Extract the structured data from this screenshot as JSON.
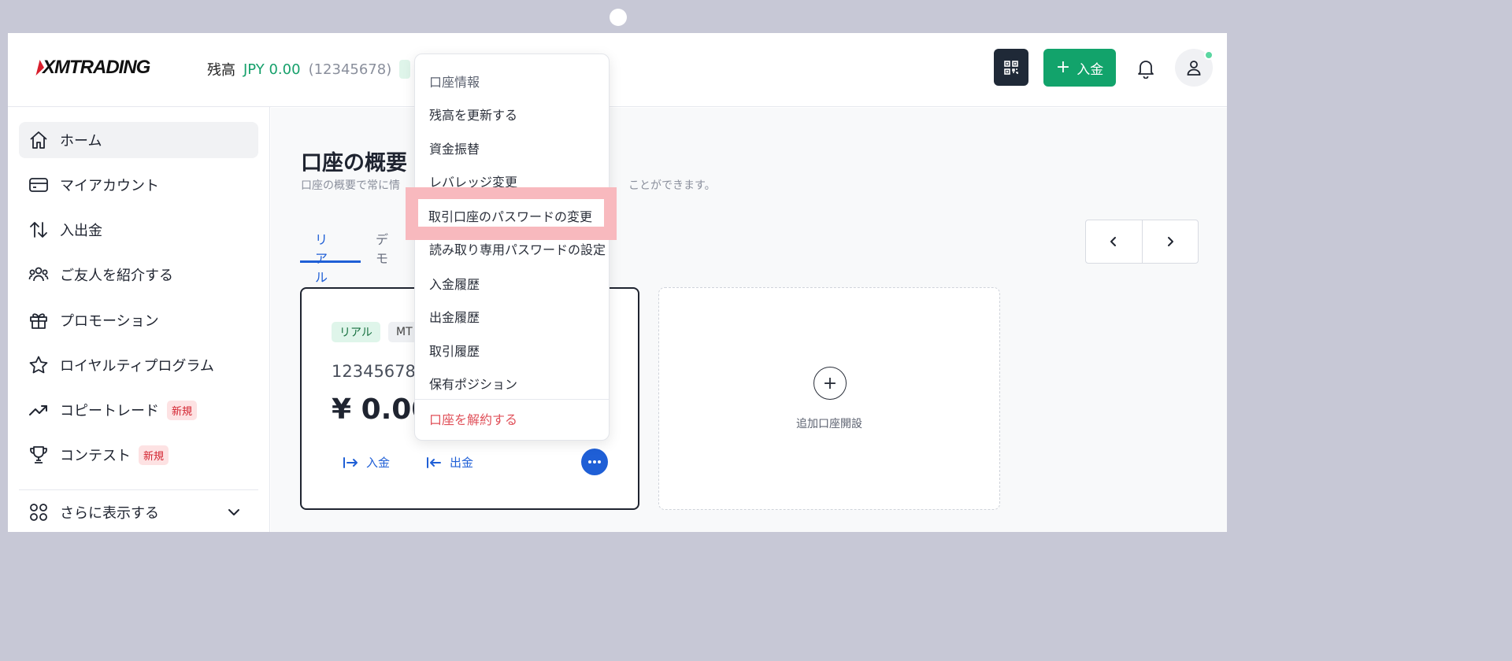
{
  "header": {
    "logo_text": "XMTRADING",
    "balance_label": "残高",
    "balance_amount": "JPY 0.00",
    "account_id": "(12345678)",
    "deposit_label": "入金",
    "icons": [
      "qr-code-icon",
      "bell-icon",
      "user-icon"
    ]
  },
  "sidebar": {
    "items": [
      {
        "label": "ホーム",
        "icon": "home-icon",
        "active": true
      },
      {
        "label": "マイアカウント",
        "icon": "wallet-icon"
      },
      {
        "label": "入出金",
        "icon": "transfer-arrows-icon"
      },
      {
        "label": "ご友人を紹介する",
        "icon": "users-icon"
      },
      {
        "label": "プロモーション",
        "icon": "gift-icon"
      },
      {
        "label": "ロイヤルティプログラム",
        "icon": "star-icon"
      },
      {
        "label": "コピートレード",
        "icon": "trending-up-icon",
        "badge": "新規"
      },
      {
        "label": "コンテスト",
        "icon": "trophy-icon",
        "badge": "新規"
      }
    ],
    "more_label": "さらに表示する"
  },
  "main": {
    "title": "口座の概要",
    "subtitle_start": "口座の概要で常に情",
    "subtitle_end": "ことができます。",
    "tabs": [
      {
        "label": "リアル",
        "active": true
      },
      {
        "label": "デモ"
      }
    ],
    "account_card": {
      "type_tag": "リアル",
      "platform_tag": "MT",
      "account_number": "12345678",
      "balance": "¥ 0.00",
      "deposit_label": "入金",
      "withdraw_label": "出金"
    },
    "add_card": {
      "label": "追加口座開設"
    }
  },
  "dropdown": {
    "items": [
      "口座情報",
      "残高を更新する",
      "資金振替",
      "レバレッジ変更",
      "取引口座のパスワードの変更",
      "読み取り専用パスワードの設定",
      "入金履歴",
      "出金履歴",
      "取引履歴",
      "保有ポジション"
    ],
    "danger_item": "口座を解約する",
    "highlighted_index": 4
  },
  "colors": {
    "accent_green": "#12a36b",
    "accent_blue": "#1f5fd6",
    "danger_red": "#e05059",
    "highlight_pink": "#f8b9be"
  }
}
